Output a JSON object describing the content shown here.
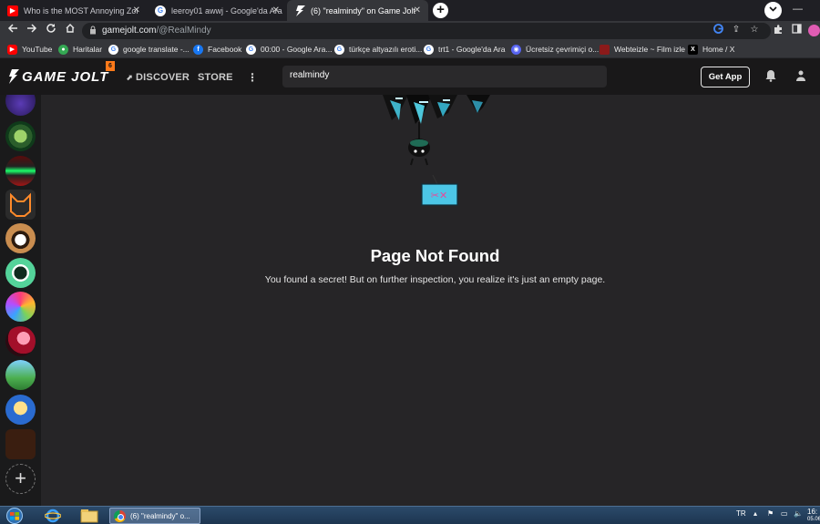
{
  "browser": {
    "tabs": [
      {
        "title": "Who is the MOST Annoying Zon",
        "favicon": "youtube-icon",
        "active": false
      },
      {
        "title": "leeroy01 awwj - Google'da Ara",
        "favicon": "google-icon",
        "active": false
      },
      {
        "title": "(6) \"realmindy\" on Game Jolt",
        "favicon": "gamejolt-icon",
        "active": true
      }
    ],
    "new_tab_label": "+",
    "address": {
      "domain": "gamejolt.com",
      "path": "/@RealMindy"
    },
    "bookmarks": [
      {
        "label": "YouTube",
        "icon": "youtube-icon",
        "color": "#ff0000"
      },
      {
        "label": "Haritalar",
        "icon": "maps-pin-icon",
        "color": "#34a853"
      },
      {
        "label": "google translate -...",
        "icon": "google-icon",
        "color": "#4285f4"
      },
      {
        "label": "Facebook",
        "icon": "facebook-icon",
        "color": "#1877f2"
      },
      {
        "label": "00:00 - Google Ara...",
        "icon": "google-icon",
        "color": "#4285f4"
      },
      {
        "label": "türkçe altyazılı eroti...",
        "icon": "google-icon",
        "color": "#4285f4"
      },
      {
        "label": "trt1 - Google'da Ara",
        "icon": "google-icon",
        "color": "#4285f4"
      },
      {
        "label": "Ücretsiz çevrimiçi o...",
        "icon": "discord-icon",
        "color": "#5865f2"
      },
      {
        "label": "Webteizle ~ Film izle",
        "icon": "webteizle-icon",
        "color": "#8b1a1a"
      },
      {
        "label": "Home / X",
        "icon": "x-icon",
        "color": "#000000"
      }
    ]
  },
  "site": {
    "logo_text": "GAME JOLT",
    "notification_count": "6",
    "nav": {
      "discover": "DISCOVER",
      "store": "STORE"
    },
    "search_value": "realmindy",
    "get_app_label": "Get App"
  },
  "page": {
    "title": "Page Not Found",
    "message": "You found a secret! But on further inspection, you realize it's just an empty page."
  },
  "taskbar": {
    "chrome_task_label": "(6) \"realmindy\" o...",
    "language": "TR",
    "time": "16:",
    "date": "05.06."
  },
  "colors": {
    "accent": "#ff7a1a",
    "header_bg": "#191819",
    "content_bg": "#262527",
    "gj_green": "#2f7f6f"
  }
}
